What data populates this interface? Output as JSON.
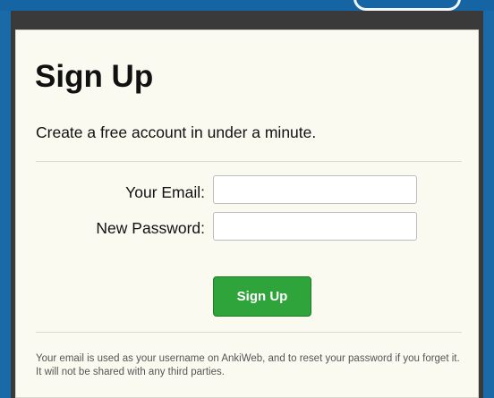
{
  "form": {
    "title": "Sign Up",
    "subtitle": "Create a free account in under a minute.",
    "email_label": "Your Email:",
    "email_value": "",
    "password_label": "New Password:",
    "password_value": "",
    "submit_label": "Sign Up",
    "footnote": "Your email is used as your username on AnkiWeb, and to reset your password if you forget it. It will not be shared with any third parties."
  },
  "colors": {
    "background": "#1b6fae",
    "card": "#fbfaf0",
    "button": "#2ea43a"
  }
}
